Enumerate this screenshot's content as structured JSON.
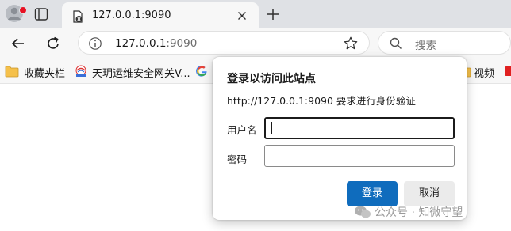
{
  "tab": {
    "title": "127.0.0.1:9090"
  },
  "address_bar": {
    "url_host": "127.0.0.1",
    "url_port": ":9090"
  },
  "search": {
    "placeholder": "搜索"
  },
  "bookmarks": {
    "items": [
      {
        "label": "收藏夹栏",
        "icon": "folder-icon"
      },
      {
        "label": "天玥运维安全网关V...",
        "icon": "site-logo-icon"
      },
      {
        "label": "",
        "icon": "google-icon"
      },
      {
        "label": "视频",
        "icon": "folder-icon"
      }
    ]
  },
  "auth_dialog": {
    "title": "登录以访问此站点",
    "message": "http://127.0.0.1:9090 要求进行身份验证",
    "username_label": "用户名",
    "password_label": "密码",
    "username_value": "",
    "password_value": "",
    "login_button": "登录",
    "cancel_button": "取消"
  },
  "watermark": {
    "text": "公众号 · 知微守望"
  },
  "colors": {
    "primary": "#0f6cbd",
    "profile_badge": "#e81123",
    "chrome_bg": "#dfe1e5"
  }
}
